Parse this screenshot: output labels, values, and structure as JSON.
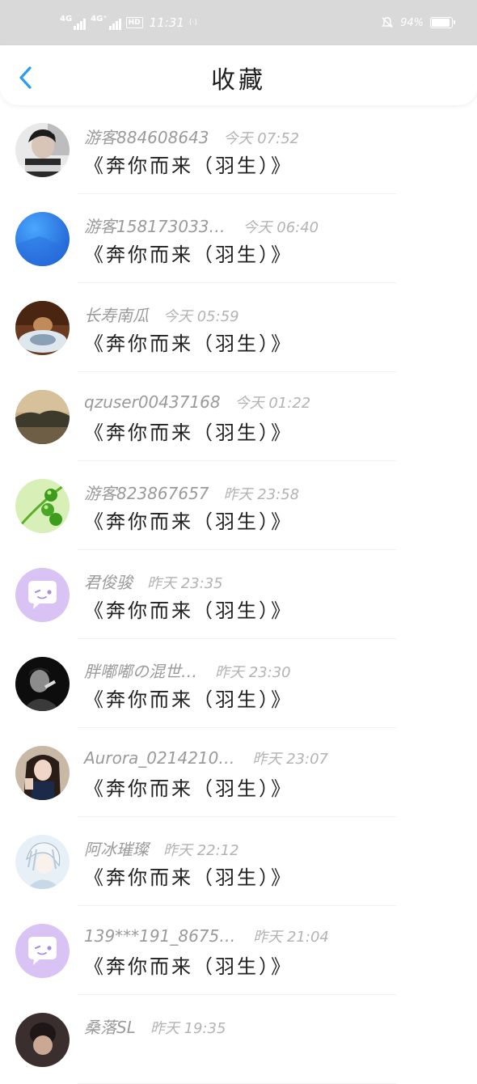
{
  "status_bar": {
    "net1": "4G",
    "net2": "4G⁺",
    "hd": "HD",
    "time": "11:31",
    "extra": "(·)",
    "battery": "94%",
    "battery_level": 0.94
  },
  "header": {
    "title": "收藏"
  },
  "items": [
    {
      "name": "游客884608643",
      "time": "今天 07:52",
      "title": "《奔你而来（羽生）》",
      "avatar": "photo-dark-portrait"
    },
    {
      "name": "游客158173033…",
      "time": "今天 06:40",
      "title": "《奔你而来（羽生）》",
      "avatar": "blue-gradient"
    },
    {
      "name": "长寿南瓜",
      "time": "今天 05:59",
      "title": "《奔你而来（羽生）》",
      "avatar": "photo-brown"
    },
    {
      "name": "qzuser00437168",
      "time": "今天 01:22",
      "title": "《奔你而来（羽生）》",
      "avatar": "photo-landscape"
    },
    {
      "name": "游客823867657",
      "time": "昨天 23:58",
      "title": "《奔你而来（羽生）》",
      "avatar": "green-peas"
    },
    {
      "name": "君俊骏",
      "time": "昨天 23:35",
      "title": "《奔你而来（羽生）》",
      "avatar": "default-chat"
    },
    {
      "name": "胖嘟嘟の混世…",
      "time": "昨天 23:30",
      "title": "《奔你而来（羽生）》",
      "avatar": "photo-bw"
    },
    {
      "name": "Aurora_0214210…",
      "time": "昨天 23:07",
      "title": "《奔你而来（羽生）》",
      "avatar": "photo-girl"
    },
    {
      "name": "阿冰璀璨",
      "time": "昨天 22:12",
      "title": "《奔你而来（羽生）》",
      "avatar": "photo-anime"
    },
    {
      "name": "139***191_8675…",
      "time": "昨天 21:04",
      "title": "《奔你而来（羽生）》",
      "avatar": "default-chat"
    },
    {
      "name": "桑落SL",
      "time": "昨天 19:35",
      "title": "",
      "avatar": "photo-partial"
    }
  ],
  "colors": {
    "accent": "#2d9cf0",
    "default_avatar": "#d9c3f5"
  }
}
